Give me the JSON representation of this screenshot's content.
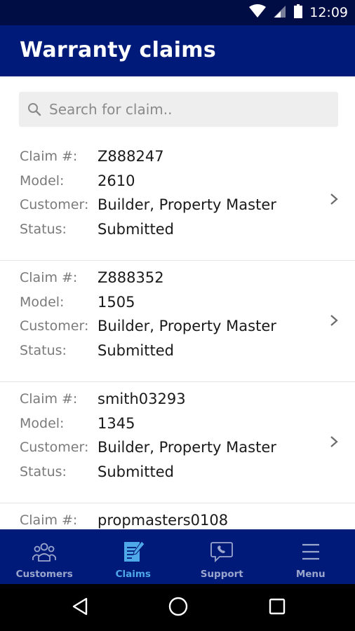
{
  "status_bar": {
    "time": "12:09"
  },
  "app_bar": {
    "title": "Warranty claims"
  },
  "search": {
    "placeholder": "Search for claim..",
    "value": ""
  },
  "labels": {
    "claim": "Claim #:",
    "model": "Model:",
    "customer": "Customer:",
    "status": "Status:"
  },
  "claims": [
    {
      "claim": "Z888247",
      "model": "2610",
      "customer": "Builder, Property Master",
      "status": "Submitted"
    },
    {
      "claim": "Z888352",
      "model": "1505",
      "customer": "Builder, Property Master",
      "status": "Submitted"
    },
    {
      "claim": "smith03293",
      "model": "1345",
      "customer": "Builder, Property Master",
      "status": "Submitted"
    },
    {
      "claim": "propmasters0108"
    }
  ],
  "bottom_nav": {
    "items": [
      {
        "label": "Customers",
        "icon": "customers-icon",
        "active": false
      },
      {
        "label": "Claims",
        "icon": "claims-icon",
        "active": true
      },
      {
        "label": "Support",
        "icon": "support-icon",
        "active": false
      },
      {
        "label": "Menu",
        "icon": "menu-icon",
        "active": false
      }
    ]
  },
  "colors": {
    "app_bar": "#001a7a",
    "status_bar": "#000c44",
    "active_nav": "#4fa8e8",
    "inactive_nav": "#9ba6cc"
  }
}
